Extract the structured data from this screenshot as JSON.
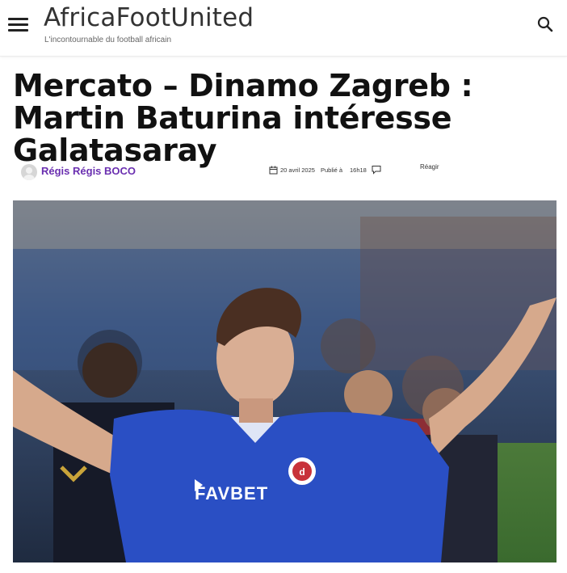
{
  "site": {
    "title": "AfricaFootUnited",
    "tagline": "L'incontournable du football africain"
  },
  "header": {
    "menu_icon": "hamburger-menu-icon",
    "search_icon": "search-icon"
  },
  "article": {
    "title": "Mercato – Dinamo Zagreb : Martin Baturina intéresse Galatasaray",
    "author": "Régis Régis BOCO",
    "date": "20 avril 2025",
    "published_label": "Publié à",
    "time": "16h18",
    "react_label": "Réagir",
    "image": {
      "sponsor_text": "FAVBET",
      "jersey_color": "#2a4fc4"
    }
  },
  "colors": {
    "author_link": "#6a2fb0",
    "title_text": "#111111"
  }
}
